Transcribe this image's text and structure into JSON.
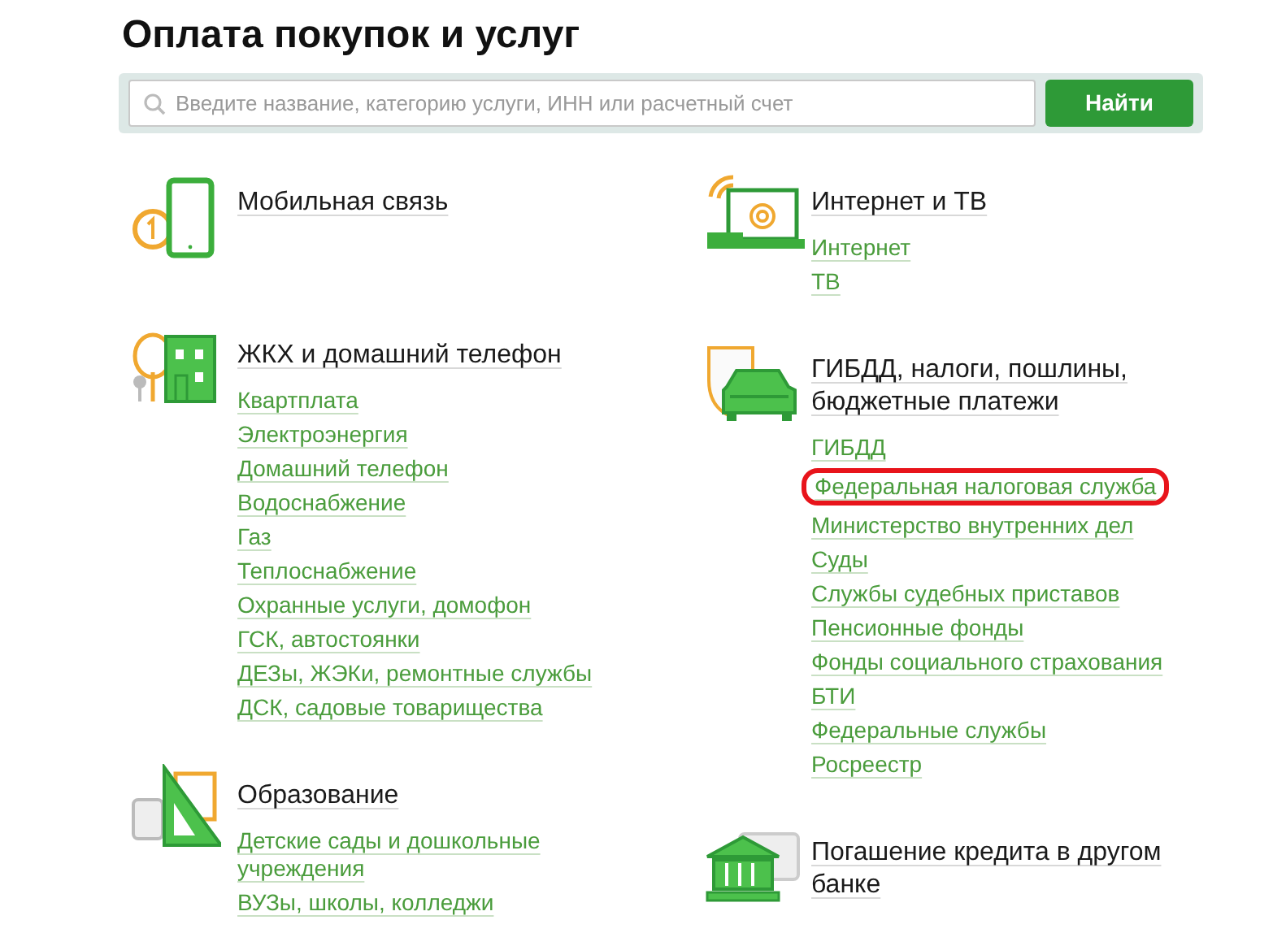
{
  "title": "Оплата покупок и услуг",
  "search": {
    "placeholder": "Введите название, категорию услуги, ИНН или расчетный счет",
    "button": "Найти"
  },
  "columns": [
    {
      "categories": [
        {
          "kind": "mobile",
          "title": "Мобильная связь"
        },
        {
          "kind": "housing",
          "title": "ЖКХ и домашний телефон",
          "links": [
            {
              "label": "Квартплата",
              "circled": false
            },
            {
              "label": "Электроэнергия",
              "circled": false
            },
            {
              "label": "Домашний телефон",
              "circled": false
            },
            {
              "label": "Водоснабжение",
              "circled": false
            },
            {
              "label": "Газ",
              "circled": false
            },
            {
              "label": "Теплоснабжение",
              "circled": false
            },
            {
              "label": "Охранные услуги, домофон",
              "circled": false
            },
            {
              "label": "ГСК, автостоянки",
              "circled": false
            },
            {
              "label": "ДЕЗы, ЖЭКи, ремонтные службы",
              "circled": false
            },
            {
              "label": "ДСК, садовые товарищества",
              "circled": false
            }
          ]
        },
        {
          "kind": "education",
          "title": "Образование",
          "links": [
            {
              "label": "Детские сады и дошкольные учреждения",
              "circled": false
            },
            {
              "label": "ВУЗы, школы, колледжи",
              "circled": false
            }
          ]
        }
      ]
    },
    {
      "categories": [
        {
          "kind": "internet",
          "title": "Интернет и ТВ",
          "links": [
            {
              "label": "Интернет",
              "circled": false
            },
            {
              "label": "ТВ",
              "circled": false
            }
          ]
        },
        {
          "kind": "traffic",
          "title": "ГИБДД, налоги, пошлины, бюджетные платежи",
          "links": [
            {
              "label": "ГИБДД",
              "circled": false
            },
            {
              "label": "Федеральная налоговая служба",
              "circled": true
            },
            {
              "label": "Министерство внутренних дел",
              "circled": false
            },
            {
              "label": "Суды",
              "circled": false
            },
            {
              "label": "Службы судебных приставов",
              "circled": false
            },
            {
              "label": "Пенсионные фонды",
              "circled": false
            },
            {
              "label": "Фонды социального страхования",
              "circled": false
            },
            {
              "label": "БТИ",
              "circled": false
            },
            {
              "label": "Федеральные службы",
              "circled": false
            },
            {
              "label": "Росреестр",
              "circled": false
            }
          ]
        },
        {
          "kind": "bank",
          "title": "Погашение кредита в другом банке"
        }
      ]
    }
  ]
}
